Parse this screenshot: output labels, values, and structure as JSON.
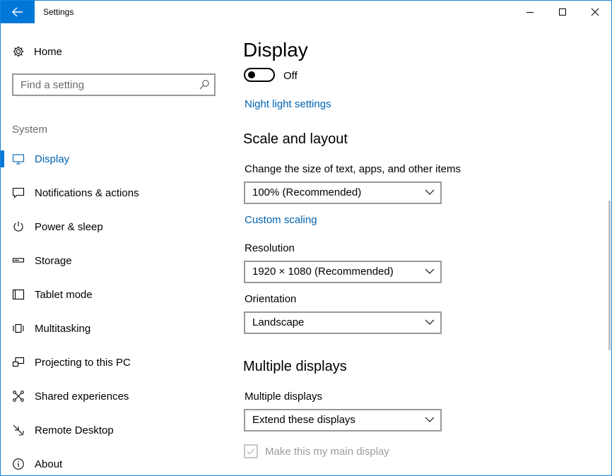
{
  "window": {
    "title": "Settings",
    "accent": "#0078d7",
    "link_color": "#0063b1"
  },
  "titlebar": {
    "back_icon": "arrow-left-icon",
    "minimize_icon": "minimize-icon",
    "maximize_icon": "maximize-icon",
    "close_icon": "close-icon"
  },
  "sidebar": {
    "home_label": "Home",
    "home_icon": "gear-icon",
    "search_placeholder": "Find a setting",
    "search_icon": "search-icon",
    "section_label": "System",
    "items": [
      {
        "label": "Display",
        "icon": "monitor-icon",
        "selected": true
      },
      {
        "label": "Notifications & actions",
        "icon": "notification-icon"
      },
      {
        "label": "Power & sleep",
        "icon": "power-icon"
      },
      {
        "label": "Storage",
        "icon": "storage-icon"
      },
      {
        "label": "Tablet mode",
        "icon": "tablet-icon"
      },
      {
        "label": "Multitasking",
        "icon": "multitasking-icon"
      },
      {
        "label": "Projecting to this PC",
        "icon": "projector-icon"
      },
      {
        "label": "Shared experiences",
        "icon": "share-icon"
      },
      {
        "label": "Remote Desktop",
        "icon": "remote-desktop-icon"
      },
      {
        "label": "About",
        "icon": "info-icon"
      }
    ]
  },
  "main": {
    "title": "Display",
    "night_light": {
      "state": "Off",
      "on": false
    },
    "night_light_link": "Night light settings",
    "scale_heading": "Scale and layout",
    "scale_label": "Change the size of text, apps, and other items",
    "scale_value": "100% (Recommended)",
    "custom_scaling_link": "Custom scaling",
    "resolution_label": "Resolution",
    "resolution_value": "1920 × 1080 (Recommended)",
    "orientation_label": "Orientation",
    "orientation_value": "Landscape",
    "multiple_heading": "Multiple displays",
    "multiple_label": "Multiple displays",
    "multiple_value": "Extend these displays",
    "main_display_label": "Make this my main display",
    "main_display_checked": true,
    "main_display_disabled": true
  }
}
